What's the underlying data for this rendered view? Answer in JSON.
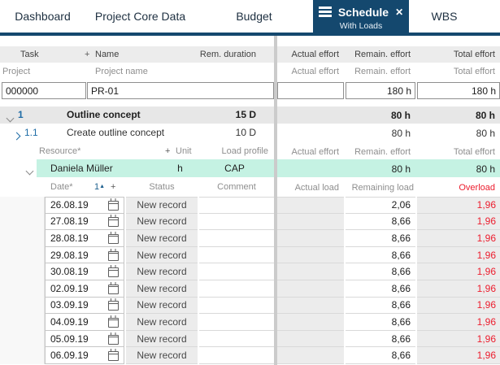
{
  "colors": {
    "accent_navy": "#14486e",
    "accent_blue": "#1e6ca6",
    "alert_red": "#ec1c2d",
    "highlight_teal": "#c5f2e3"
  },
  "tabs": {
    "close_glyph": "✕",
    "items": [
      {
        "label": "Dashboard"
      },
      {
        "label": "Project Core Data"
      },
      {
        "label": "Budget"
      },
      {
        "label": "Schedule",
        "sub": "With Loads"
      },
      {
        "label": "WBS"
      }
    ]
  },
  "task_table": {
    "header1": {
      "task": "Task",
      "plus": "+",
      "name": "Name",
      "rem_duration": "Rem. duration",
      "actual_effort": "Actual effort",
      "remain_effort": "Remain. effort",
      "total_effort": "Total effort"
    },
    "header2": {
      "task": "Project",
      "name": "Project name",
      "actual_effort": "Actual effort",
      "remain_effort": "Remain. effort",
      "total_effort": "Total effort"
    },
    "project_row": {
      "id": "000000",
      "name": "PR-01",
      "actual_effort": "",
      "remain_effort": "180 h",
      "total_effort": "180 h"
    },
    "rows": [
      {
        "num": "1",
        "name": "Outline concept",
        "rem_duration": "15 D",
        "actual_effort": "",
        "remain_effort": "80 h",
        "total_effort": "80 h"
      },
      {
        "num": "1.1",
        "name": "Create outline concept",
        "rem_duration": "10 D",
        "actual_effort": "",
        "remain_effort": "80 h",
        "total_effort": "80 h"
      }
    ]
  },
  "resource_table": {
    "header": {
      "resource": "Resource*",
      "plus": "+",
      "unit": "Unit",
      "load_profile": "Load profile",
      "actual_effort": "Actual effort",
      "remain_effort": "Remain. effort",
      "total_effort": "Total effort"
    },
    "row": {
      "name": "Daniela Müller",
      "unit": "h",
      "load_profile": "CAP",
      "actual_effort": "",
      "remain_effort": "80 h",
      "total_effort": "80 h"
    }
  },
  "load_table": {
    "header": {
      "date": "Date*",
      "sort_number": "1",
      "sort_arrow": "▲",
      "plus": "+",
      "status": "Status",
      "comment": "Comment",
      "actual_load": "Actual load",
      "remaining_load": "Remaining load",
      "overload": "Overload"
    },
    "rows": [
      {
        "date": "26.08.19",
        "status": "New record",
        "comment": "",
        "actual_load": "",
        "remaining_load": "2,06",
        "overload": "1,96"
      },
      {
        "date": "27.08.19",
        "status": "New record",
        "comment": "",
        "actual_load": "",
        "remaining_load": "8,66",
        "overload": "1,96"
      },
      {
        "date": "28.08.19",
        "status": "New record",
        "comment": "",
        "actual_load": "",
        "remaining_load": "8,66",
        "overload": "1,96"
      },
      {
        "date": "29.08.19",
        "status": "New record",
        "comment": "",
        "actual_load": "",
        "remaining_load": "8,66",
        "overload": "1,96"
      },
      {
        "date": "30.08.19",
        "status": "New record",
        "comment": "",
        "actual_load": "",
        "remaining_load": "8,66",
        "overload": "1,96"
      },
      {
        "date": "02.09.19",
        "status": "New record",
        "comment": "",
        "actual_load": "",
        "remaining_load": "8,66",
        "overload": "1,96"
      },
      {
        "date": "03.09.19",
        "status": "New record",
        "comment": "",
        "actual_load": "",
        "remaining_load": "8,66",
        "overload": "1,96"
      },
      {
        "date": "04.09.19",
        "status": "New record",
        "comment": "",
        "actual_load": "",
        "remaining_load": "8,66",
        "overload": "1,96"
      },
      {
        "date": "05.09.19",
        "status": "New record",
        "comment": "",
        "actual_load": "",
        "remaining_load": "8,66",
        "overload": "1,96"
      },
      {
        "date": "06.09.19",
        "status": "New record",
        "comment": "",
        "actual_load": "",
        "remaining_load": "8,66",
        "overload": "1,96"
      }
    ]
  }
}
